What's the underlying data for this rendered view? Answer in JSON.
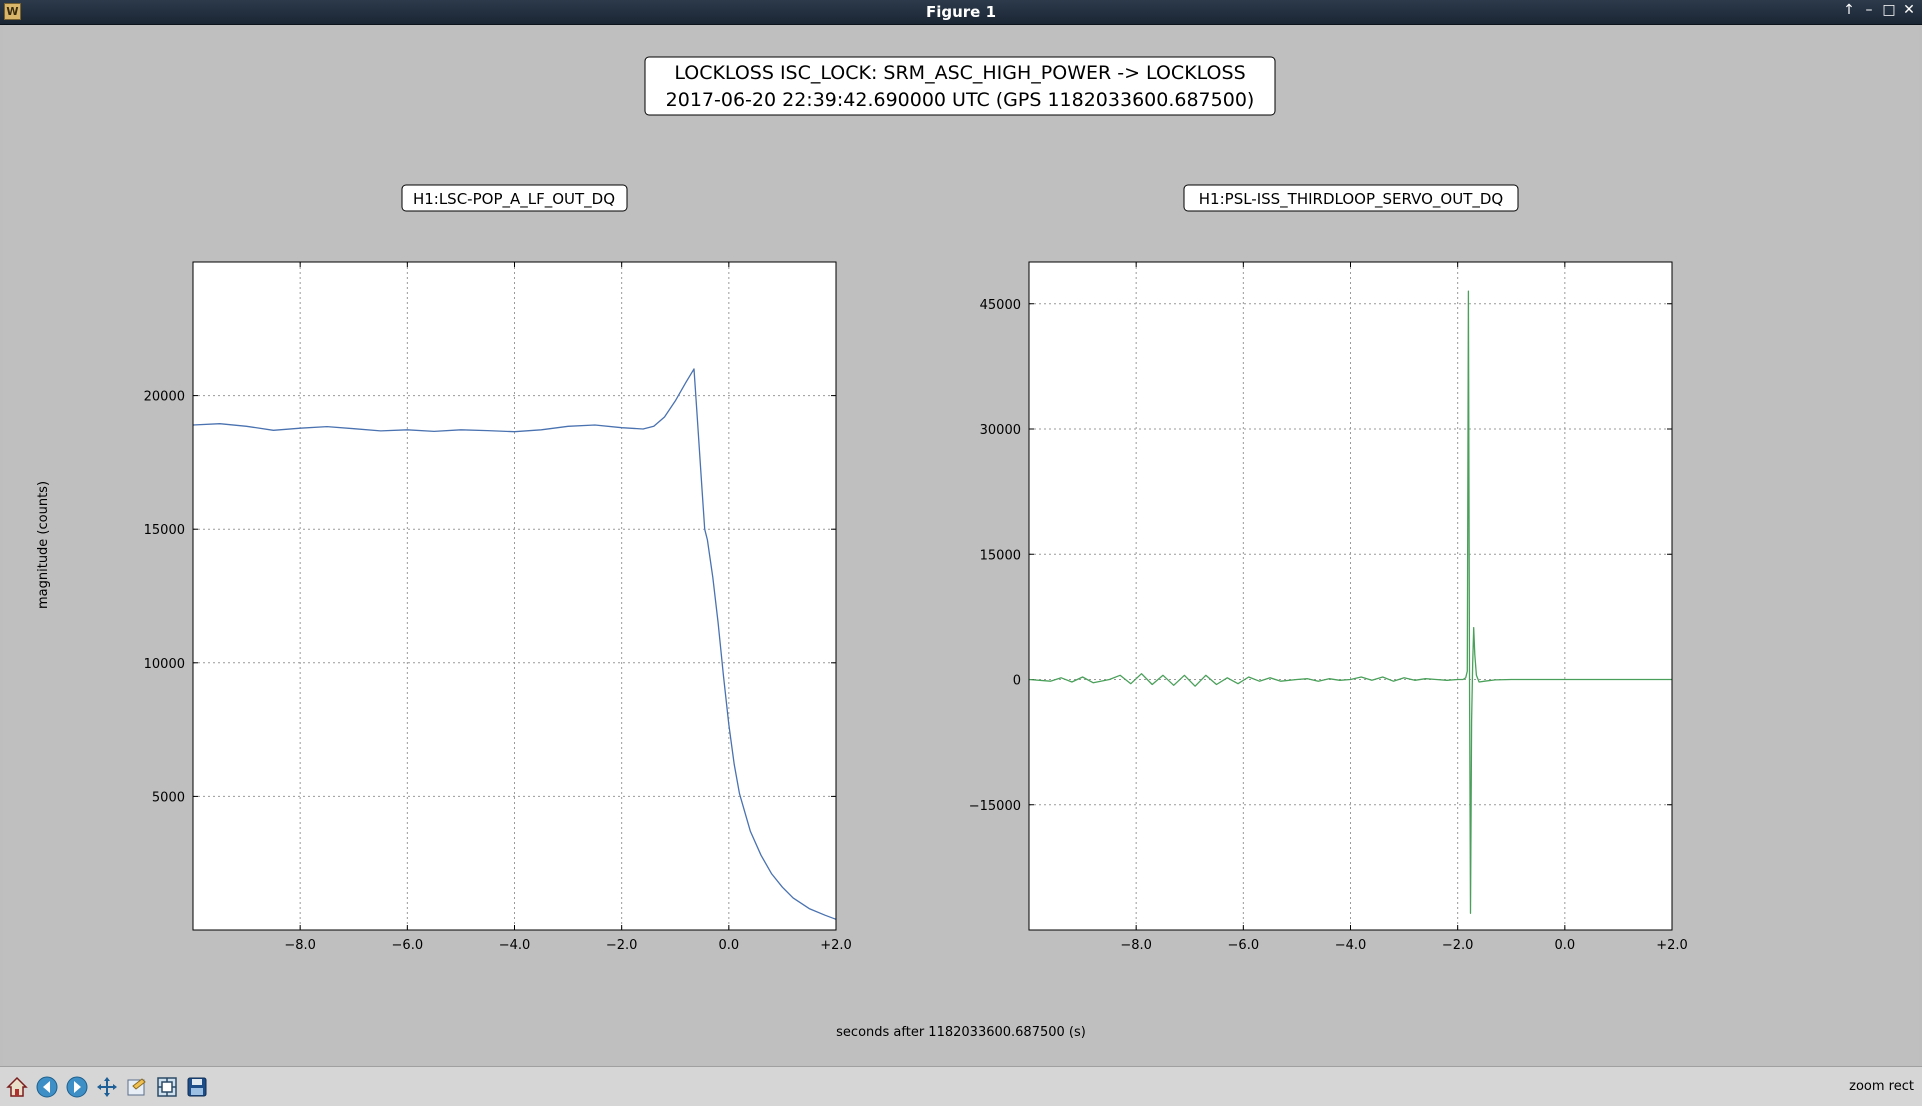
{
  "window": {
    "title": "Figure 1",
    "app_icon_glyph": "W",
    "controls": [
      "↑",
      "–",
      "□",
      "✕"
    ]
  },
  "figure": {
    "suptitle_line1": "LOCKLOSS ISC_LOCK: SRM_ASC_HIGH_POWER -> LOCKLOSS",
    "suptitle_line2": "2017-06-20 22:39:42.690000 UTC (GPS 1182033600.687500)",
    "xlabel": "seconds after 1182033600.687500 (s)",
    "ylabel": "magnitude (counts)"
  },
  "toolbar": {
    "buttons": [
      "home-icon",
      "back-icon",
      "forward-icon",
      "pan-icon",
      "zoom-icon",
      "configure-subplots-icon",
      "save-icon"
    ],
    "status": "zoom rect"
  },
  "chart_data": [
    {
      "type": "line",
      "title": "H1:LSC-POP_A_LF_OUT_DQ",
      "xlim": [
        -10,
        2
      ],
      "ylim": [
        0,
        25000
      ],
      "xticks": [
        -8,
        -6,
        -4,
        -2,
        0,
        2
      ],
      "xtick_labels": [
        "−8.0",
        "−6.0",
        "−4.0",
        "−2.0",
        "0.0",
        "+2.0"
      ],
      "yticks": [
        5000,
        10000,
        15000,
        20000
      ],
      "ytick_labels": [
        "5000",
        "10000",
        "15000",
        "20000"
      ],
      "grid": true,
      "color": "#4a72b0",
      "series": [
        {
          "x": [
            -10,
            -9.5,
            -9,
            -8.5,
            -8,
            -7.5,
            -7,
            -6.5,
            -6,
            -5.5,
            -5,
            -4.5,
            -4,
            -3.5,
            -3,
            -2.5,
            -2,
            -1.6,
            -1.4,
            -1.2,
            -1.0,
            -0.8,
            -0.65,
            -0.6,
            -0.5,
            -0.45,
            -0.4,
            -0.3,
            -0.2,
            -0.1,
            0.0,
            0.1,
            0.2,
            0.4,
            0.6,
            0.8,
            1.0,
            1.2,
            1.5,
            1.8,
            2.0
          ],
          "y": [
            18900,
            18950,
            18850,
            18700,
            18780,
            18840,
            18760,
            18680,
            18720,
            18660,
            18720,
            18690,
            18650,
            18720,
            18850,
            18900,
            18800,
            18750,
            18850,
            19200,
            19800,
            20500,
            21000,
            19500,
            16500,
            15000,
            14600,
            13200,
            11500,
            9500,
            7700,
            6200,
            5100,
            3700,
            2800,
            2100,
            1600,
            1200,
            800,
            550,
            400
          ]
        }
      ]
    },
    {
      "type": "line",
      "title": "H1:PSL-ISS_THIRDLOOP_SERVO_OUT_DQ",
      "xlim": [
        -10,
        2
      ],
      "ylim": [
        -30000,
        50000
      ],
      "xticks": [
        -8,
        -6,
        -4,
        -2,
        0,
        2
      ],
      "xtick_labels": [
        "−8.0",
        "−6.0",
        "−4.0",
        "−2.0",
        "0.0",
        "+2.0"
      ],
      "yticks": [
        -15000,
        0,
        15000,
        30000,
        45000
      ],
      "ytick_labels": [
        "−15000",
        "0",
        "15000",
        "30000",
        "45000"
      ],
      "grid": true,
      "color": "#4aa05a",
      "series": [
        {
          "x": [
            -10,
            -9.6,
            -9.4,
            -9.2,
            -9.0,
            -8.8,
            -8.5,
            -8.3,
            -8.1,
            -7.9,
            -7.7,
            -7.5,
            -7.3,
            -7.1,
            -6.9,
            -6.7,
            -6.5,
            -6.3,
            -6.1,
            -5.9,
            -5.7,
            -5.5,
            -5.3,
            -5.0,
            -4.8,
            -4.6,
            -4.4,
            -4.2,
            -4.0,
            -3.8,
            -3.6,
            -3.4,
            -3.2,
            -3.0,
            -2.8,
            -2.6,
            -2.4,
            -2.2,
            -2.0,
            -1.9,
            -1.85,
            -1.82,
            -1.8,
            -1.78,
            -1.76,
            -1.74,
            -1.72,
            -1.7,
            -1.68,
            -1.65,
            -1.6,
            -1.5,
            -1.3,
            -1.0,
            0.0,
            1.0,
            2.0
          ],
          "y": [
            0,
            -200,
            200,
            -300,
            300,
            -400,
            0,
            500,
            -500,
            700,
            -600,
            500,
            -700,
            500,
            -800,
            500,
            -600,
            200,
            -500,
            300,
            -200,
            200,
            -200,
            0,
            100,
            -200,
            100,
            -100,
            0,
            300,
            -100,
            300,
            -200,
            200,
            -100,
            100,
            0,
            -100,
            0,
            0,
            200,
            1000,
            46500,
            500,
            -28000,
            -5000,
            2000,
            6200,
            3000,
            500,
            -300,
            -200,
            -50,
            0,
            0,
            0,
            0
          ]
        }
      ]
    }
  ]
}
